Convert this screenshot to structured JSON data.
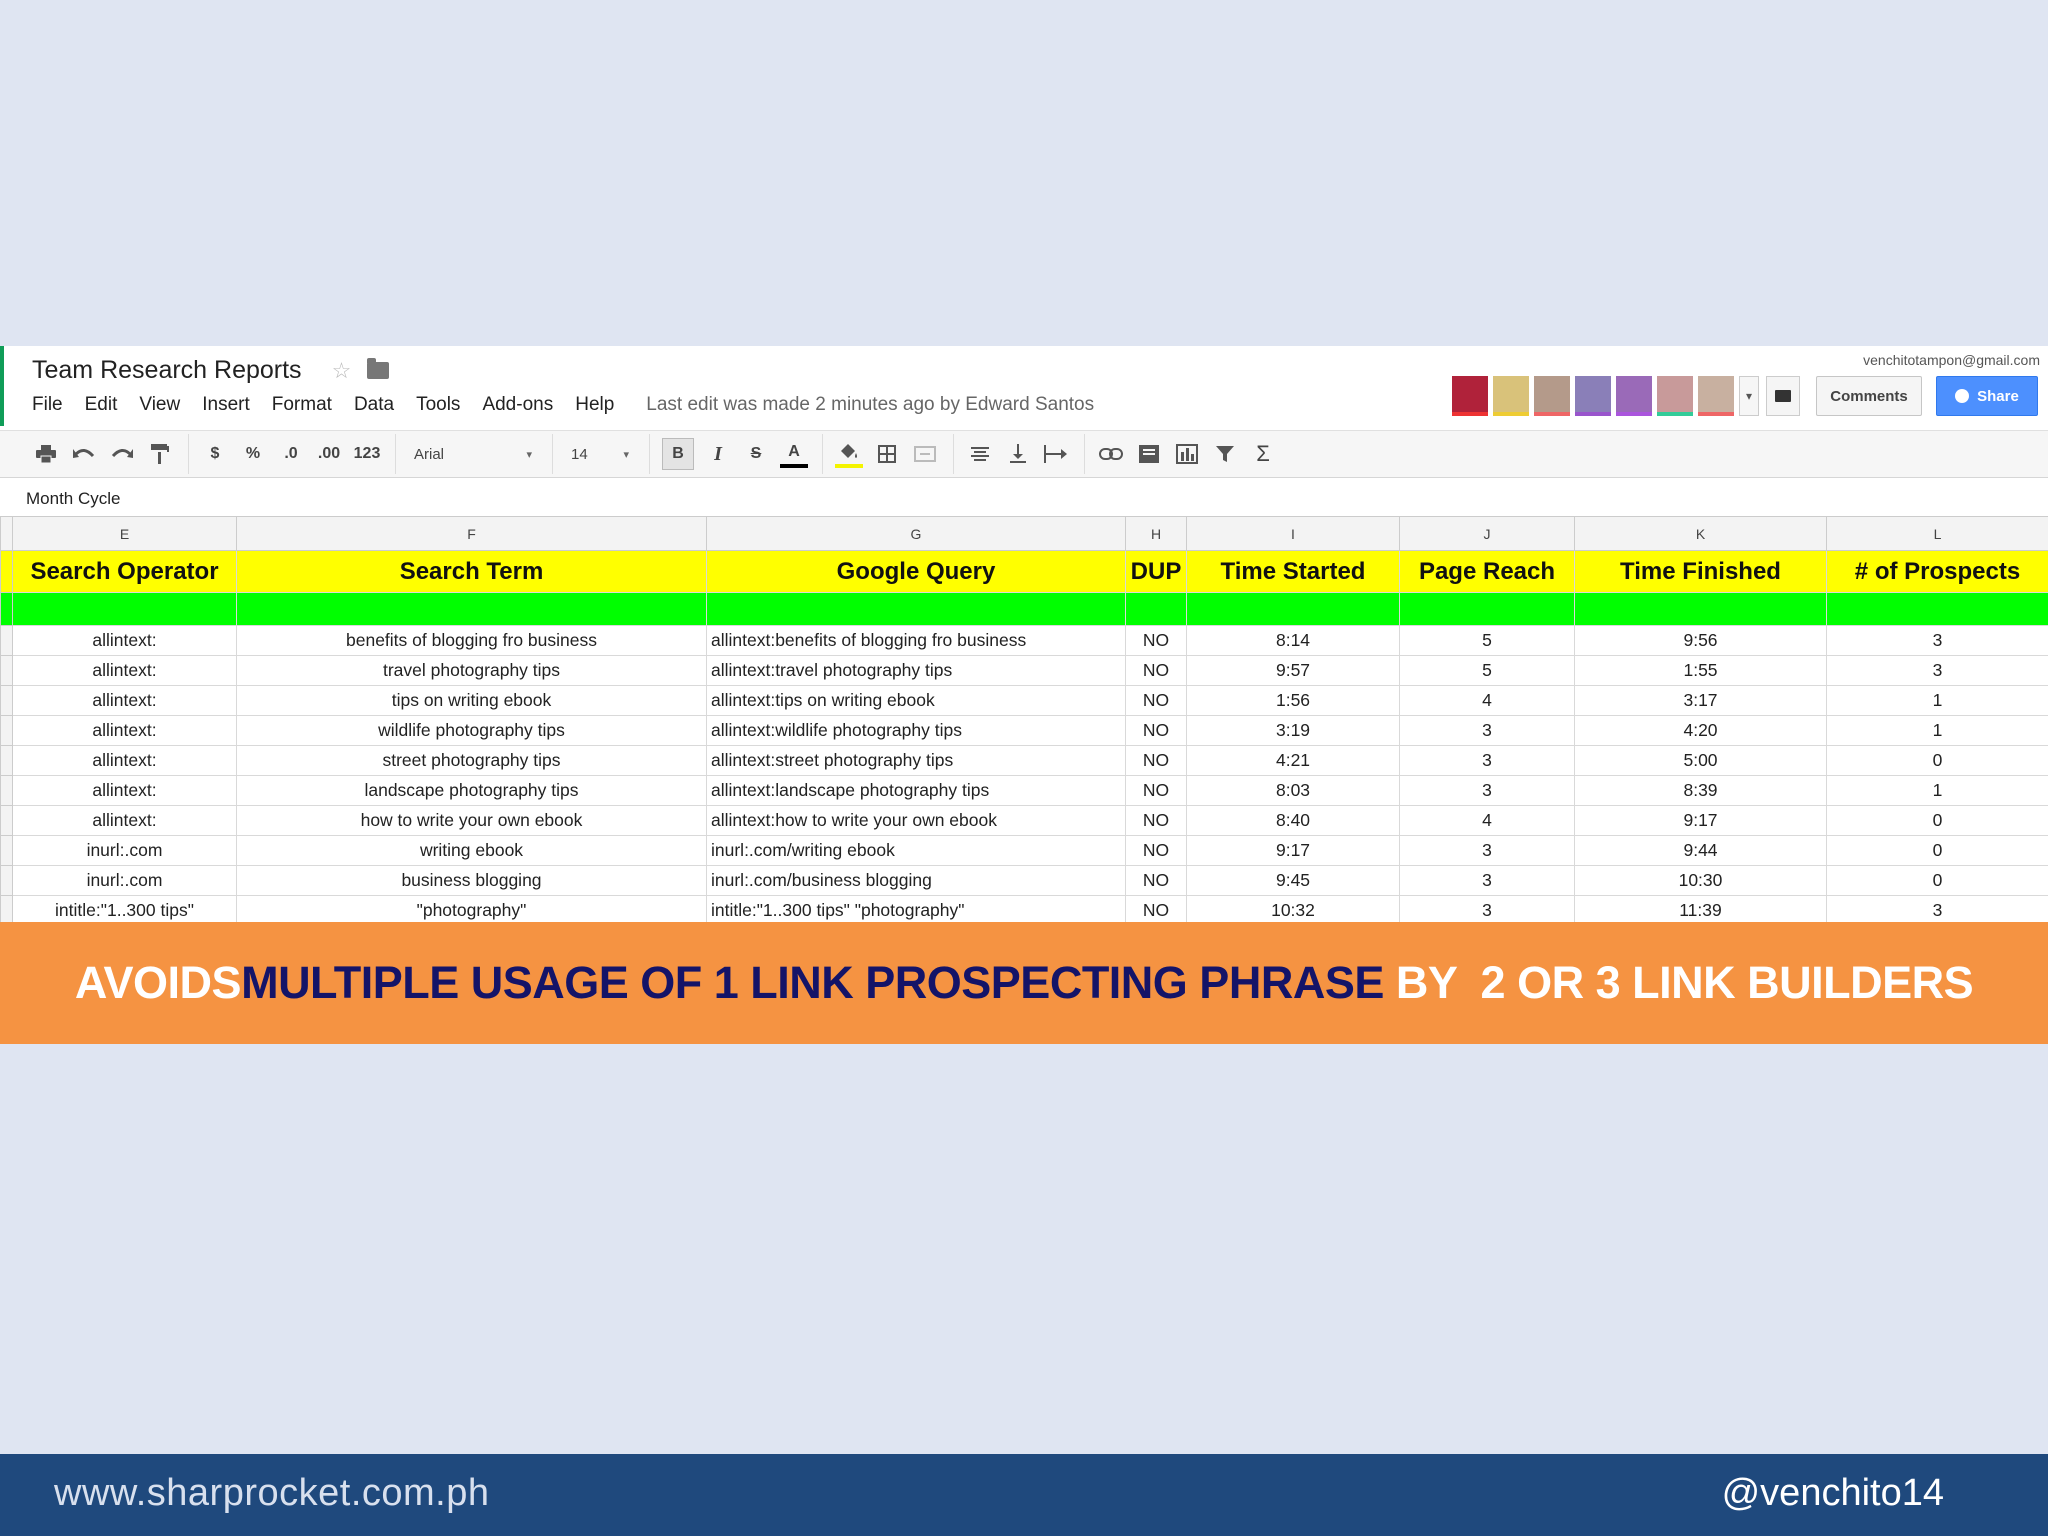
{
  "app": {
    "title": "Team Research Reports",
    "user_email": "venchitotampon@gmail.com",
    "last_edit": "Last edit was made 2 minutes ago by Edward Santos",
    "comments_label": "Comments",
    "share_label": "Share",
    "star_glyph": "☆",
    "menu": [
      "File",
      "Edit",
      "View",
      "Insert",
      "Format",
      "Data",
      "Tools",
      "Add-ons",
      "Help"
    ]
  },
  "toolbar": {
    "currency": "$",
    "percent": "%",
    "decrease_decimals": ".0",
    "increase_decimals": ".00",
    "number_format": "123",
    "font": "Arial",
    "font_size": "14",
    "bold": "B",
    "italic": "I",
    "strike": "S",
    "text_color": "A",
    "sum": "Σ",
    "caret": "▾"
  },
  "formula_bar": {
    "value": "Month Cycle"
  },
  "sheet": {
    "column_letters": [
      "E",
      "F",
      "G",
      "H",
      "I",
      "J",
      "K",
      "L"
    ],
    "headers": [
      "Search Operator",
      "Search Term",
      "Google Query",
      "DUP",
      "Time Started",
      "Page Reach",
      "Time Finished",
      "# of Prospects"
    ],
    "rows": [
      [
        "allintext:",
        "benefits of blogging fro business",
        "allintext:benefits of blogging fro business",
        "NO",
        "8:14",
        "5",
        "9:56",
        "3"
      ],
      [
        "allintext:",
        "travel photography tips",
        "allintext:travel photography tips",
        "NO",
        "9:57",
        "5",
        "1:55",
        "3"
      ],
      [
        "allintext:",
        "tips on writing ebook",
        "allintext:tips on writing ebook",
        "NO",
        "1:56",
        "4",
        "3:17",
        "1"
      ],
      [
        "allintext:",
        "wildlife photography tips",
        "allintext:wildlife photography tips",
        "NO",
        "3:19",
        "3",
        "4:20",
        "1"
      ],
      [
        "allintext:",
        "street photography tips",
        "allintext:street photography tips",
        "NO",
        "4:21",
        "3",
        "5:00",
        "0"
      ],
      [
        "allintext:",
        "landscape photography tips",
        "allintext:landscape photography tips",
        "NO",
        "8:03",
        "3",
        "8:39",
        "1"
      ],
      [
        "allintext:",
        "how to write your own ebook",
        "allintext:how to write your own ebook",
        "NO",
        "8:40",
        "4",
        "9:17",
        "0"
      ],
      [
        "inurl:.com",
        "writing ebook",
        "inurl:.com/writing ebook",
        "NO",
        "9:17",
        "3",
        "9:44",
        "0"
      ],
      [
        "inurl:.com",
        "business blogging",
        "inurl:.com/business blogging",
        "NO",
        "9:45",
        "3",
        "10:30",
        "0"
      ],
      [
        "intitle:\"1..300 tips\"",
        "\"photography\"",
        "intitle:\"1..300 tips\" \"photography\"",
        "NO",
        "10:32",
        "3",
        "11:39",
        "3"
      ]
    ]
  },
  "banner": {
    "part1": "AVOIDS ",
    "part2": "MULTIPLE USAGE OF 1 LINK PROSPECTING PHRASE",
    "part3": " BY  2 OR 3 LINK BUILDERS"
  },
  "footer": {
    "website": "www.sharprocket.com.ph",
    "handle": "@venchito14"
  },
  "colors": {
    "header_fill": "#ffff00",
    "separator_row": "#00ff00",
    "banner": "#f59342",
    "banner_emphasis": "#141468",
    "footer": "#1f497d",
    "share_button": "#4d90fe"
  }
}
